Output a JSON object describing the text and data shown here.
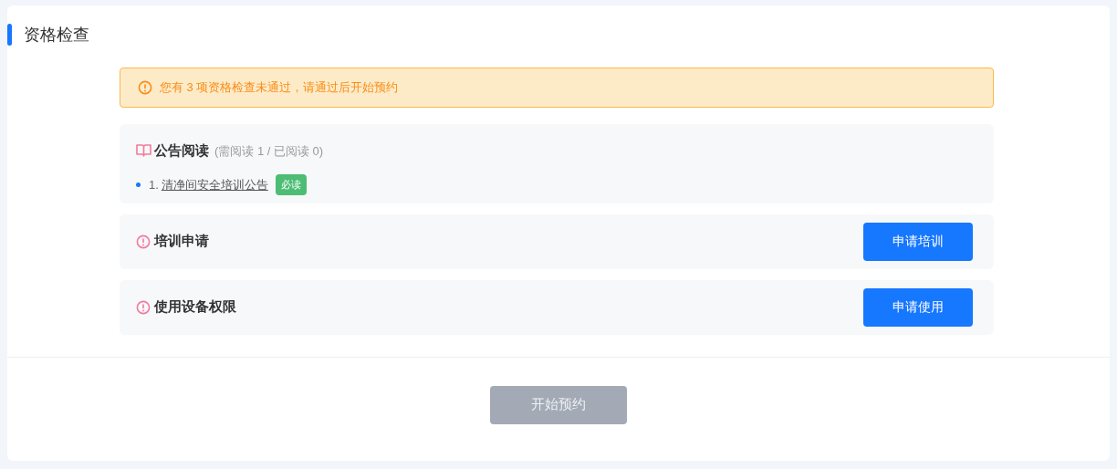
{
  "title": "资格检查",
  "alert": {
    "text": "您有 3 项资格检查未通过，请通过后开始预约"
  },
  "notice": {
    "title": "公告阅读",
    "summary": "(需阅读 1 / 已阅读 0)",
    "items": [
      {
        "number": "1.",
        "link": "清净间安全培训公告",
        "tag": "必读"
      }
    ]
  },
  "checks": [
    {
      "title": "培训申请",
      "button": "申请培训"
    },
    {
      "title": "使用设备权限",
      "button": "申请使用"
    }
  ],
  "start_button": {
    "label": "开始预约",
    "disabled": true
  }
}
